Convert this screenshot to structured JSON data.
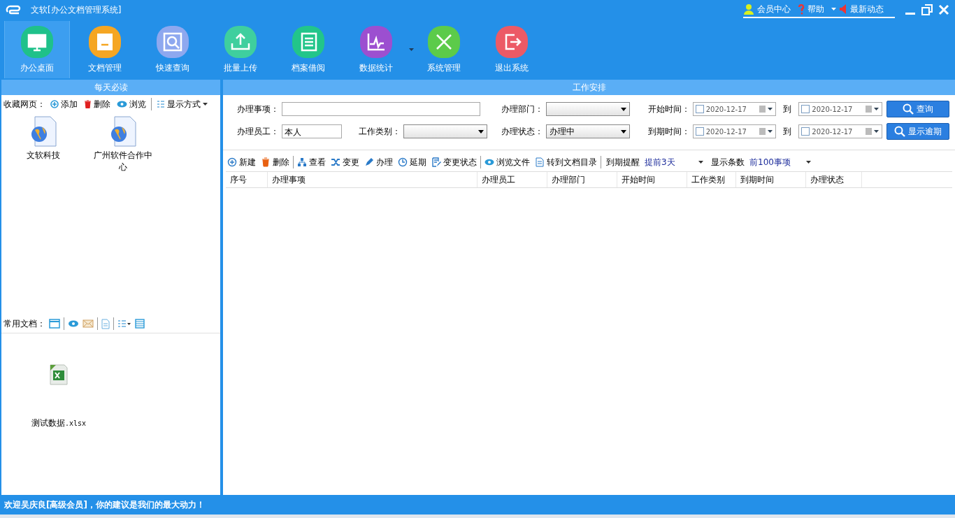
{
  "window": {
    "title": "文软[办公文档管理系统]",
    "links": [
      {
        "label": "会员中心",
        "kind": "user"
      },
      {
        "label": "帮助",
        "kind": "help"
      },
      {
        "label": "最新动态",
        "kind": "news"
      }
    ]
  },
  "nav": [
    {
      "label": "办公桌面",
      "color": "#1fc18a",
      "selected": true,
      "has_menu": false
    },
    {
      "label": "文档管理",
      "color": "#f5a623",
      "selected": false,
      "has_menu": false
    },
    {
      "label": "快速查询",
      "color": "#8ea8ef",
      "selected": false,
      "has_menu": false
    },
    {
      "label": "批量上传",
      "color": "#3fcf9e",
      "selected": false,
      "has_menu": false
    },
    {
      "label": "档案借阅",
      "color": "#22c58a",
      "selected": false,
      "has_menu": false
    },
    {
      "label": "数据统计",
      "color": "#9c4fd0",
      "selected": false,
      "has_menu": true
    },
    {
      "label": "系统管理",
      "color": "#5ccb4a",
      "selected": false,
      "has_menu": false
    },
    {
      "label": "退出系统",
      "color": "#ec5a66",
      "selected": false,
      "has_menu": false
    }
  ],
  "daily": {
    "title": "每天必读",
    "label": "收藏网页：",
    "actions": [
      {
        "label": "添加",
        "kind": "add"
      },
      {
        "label": "删除",
        "kind": "delete"
      },
      {
        "label": "浏览",
        "kind": "view"
      }
    ],
    "view_mode": "显示方式",
    "items": [
      {
        "label": "文软科技"
      },
      {
        "label": "广州软件合作中心"
      }
    ]
  },
  "docs": {
    "label": "常用文档：",
    "items": [
      {
        "label": "测试数据",
        "ext": ".xlsx"
      }
    ]
  },
  "work": {
    "title": "工作安排",
    "form_rows": [
      [
        {
          "kind": "text",
          "label": "办理事项："
        },
        {
          "kind": "select",
          "label": "办理部门："
        },
        {
          "kind": "daterange",
          "label": "开始时间：",
          "from": "2020-12-17",
          "to": "2020-12-17",
          "from_checked": false,
          "to_checked": false,
          "sep": "到"
        },
        {
          "kind": "button",
          "label": "查询"
        }
      ],
      [
        {
          "kind": "shorttext",
          "label": "办理员工：",
          "value": "本人"
        },
        {
          "kind": "select",
          "label": "工作类别："
        },
        {
          "kind": "select",
          "label": "办理状态：",
          "value": "办理中"
        },
        {
          "kind": "daterange",
          "label": "到期时间：",
          "from": "2020-12-17",
          "to": "2020-12-17",
          "from_checked": false,
          "to_checked": false,
          "sep": "到"
        },
        {
          "kind": "button",
          "label": "显示逾期"
        }
      ]
    ],
    "toolbar": [
      [
        {
          "label": "新建",
          "kind": "new"
        },
        {
          "label": "删除",
          "kind": "delete"
        }
      ],
      [
        {
          "label": "查看",
          "kind": "tree"
        },
        {
          "label": "变更",
          "kind": "shuffle"
        },
        {
          "label": "办理",
          "kind": "pen"
        },
        {
          "label": "延期",
          "kind": "clock"
        },
        {
          "label": "变更状态",
          "kind": "edit"
        }
      ],
      [
        {
          "label": "浏览文件",
          "kind": "view"
        },
        {
          "label": "转到文档目录",
          "kind": "doc"
        }
      ]
    ],
    "remind": {
      "label": "到期提醒",
      "value": "提前3天"
    },
    "count": {
      "label": "显示条数",
      "value": "前100事项"
    },
    "columns": [
      "序号",
      "办理事项",
      "办理员工",
      "办理部门",
      "开始时间",
      "工作类别",
      "到期时间",
      "办理状态"
    ]
  },
  "status_bar": "欢迎吴庆良[高级会员]，你的建议是我们的最大动力！"
}
